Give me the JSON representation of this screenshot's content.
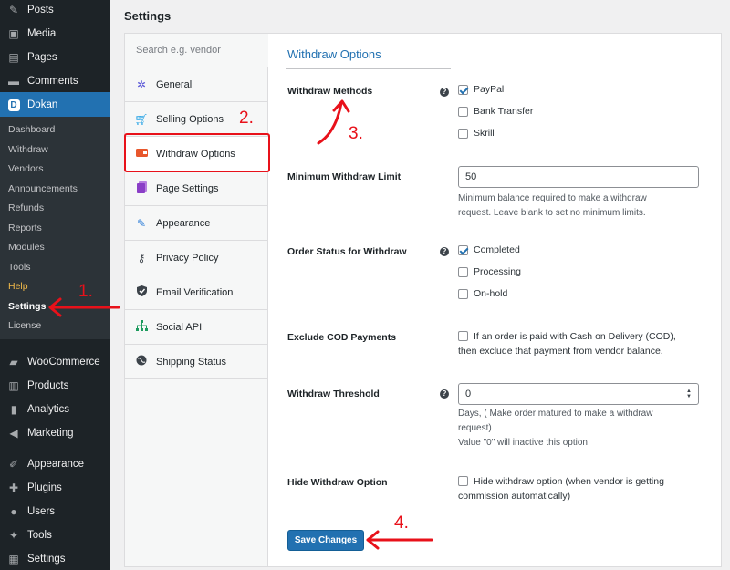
{
  "sidebar": {
    "top_items": [
      {
        "label": "Posts",
        "icon": "pin-icon"
      },
      {
        "label": "Media",
        "icon": "media-icon"
      },
      {
        "label": "Pages",
        "icon": "pages-icon"
      },
      {
        "label": "Comments",
        "icon": "comments-icon"
      },
      {
        "label": "Dokan",
        "icon": "dokan-icon"
      }
    ],
    "dokan_submenu": [
      "Dashboard",
      "Withdraw",
      "Vendors",
      "Announcements",
      "Refunds",
      "Reports",
      "Modules",
      "Tools",
      "Help",
      "Settings",
      "License"
    ],
    "bottom_items": [
      {
        "label": "WooCommerce",
        "icon": "woocommerce-icon"
      },
      {
        "label": "Products",
        "icon": "products-icon"
      },
      {
        "label": "Analytics",
        "icon": "analytics-icon"
      },
      {
        "label": "Marketing",
        "icon": "marketing-icon"
      },
      {
        "label": "Appearance",
        "icon": "appearance-icon"
      },
      {
        "label": "Plugins",
        "icon": "plugins-icon"
      },
      {
        "label": "Users",
        "icon": "users-icon"
      },
      {
        "label": "Tools",
        "icon": "tools-icon"
      },
      {
        "label": "Settings",
        "icon": "settings-icon"
      }
    ],
    "active_color": "#2271b1",
    "help_color": "#f0b849"
  },
  "page": {
    "title": "Settings"
  },
  "settings_nav": {
    "search_placeholder": "Search e.g. vendor",
    "items": [
      {
        "label": "General",
        "icon": "gear-icon",
        "color": "#5b59d8"
      },
      {
        "label": "Selling Options",
        "icon": "cart-icon",
        "color": "#1ea0e5"
      },
      {
        "label": "Withdraw Options",
        "icon": "withdraw-icon",
        "color": "#e8572c"
      },
      {
        "label": "Page Settings",
        "icon": "page-icon",
        "color": "#8a3ec7"
      },
      {
        "label": "Appearance",
        "icon": "brush-icon",
        "color": "#2d7ed8"
      },
      {
        "label": "Privacy Policy",
        "icon": "key-icon",
        "color": "#3c434a"
      },
      {
        "label": "Email Verification",
        "icon": "shield-icon",
        "color": "#3c434a"
      },
      {
        "label": "Social API",
        "icon": "network-icon",
        "color": "#1d9b5e"
      },
      {
        "label": "Shipping Status",
        "icon": "globe-icon",
        "color": "#3c434a"
      }
    ],
    "active_index": 2
  },
  "withdraw": {
    "section_title": "Withdraw Options",
    "methods": {
      "label": "Withdraw Methods",
      "options": [
        {
          "label": "PayPal",
          "checked": true
        },
        {
          "label": "Bank Transfer",
          "checked": false
        },
        {
          "label": "Skrill",
          "checked": false
        }
      ]
    },
    "min_limit": {
      "label": "Minimum Withdraw Limit",
      "value": "50",
      "help_1": "Minimum balance required to make a withdraw",
      "help_2": "request. Leave blank to set no minimum limits."
    },
    "order_status": {
      "label": "Order Status for Withdraw",
      "options": [
        {
          "label": "Completed",
          "checked": true
        },
        {
          "label": "Processing",
          "checked": false
        },
        {
          "label": "On-hold",
          "checked": false
        }
      ]
    },
    "exclude_cod": {
      "label": "Exclude COD Payments",
      "text_1": "If an order is paid with Cash on Delivery (COD),",
      "text_2": "then exclude that payment from vendor balance.",
      "checked": false
    },
    "threshold": {
      "label": "Withdraw Threshold",
      "value": "0",
      "help_1": "Days, ( Make order matured to make a withdraw",
      "help_2": "request)",
      "help_3": "Value \"0\" will inactive this option"
    },
    "hide_option": {
      "label": "Hide Withdraw Option",
      "text_1": "Hide withdraw option (when vendor is getting",
      "text_2": "commission automatically)",
      "checked": false
    },
    "save_label": "Save Changes"
  },
  "annotations": {
    "color": "#e8111a",
    "labels": [
      "1.",
      "2.",
      "3.",
      "4."
    ]
  }
}
